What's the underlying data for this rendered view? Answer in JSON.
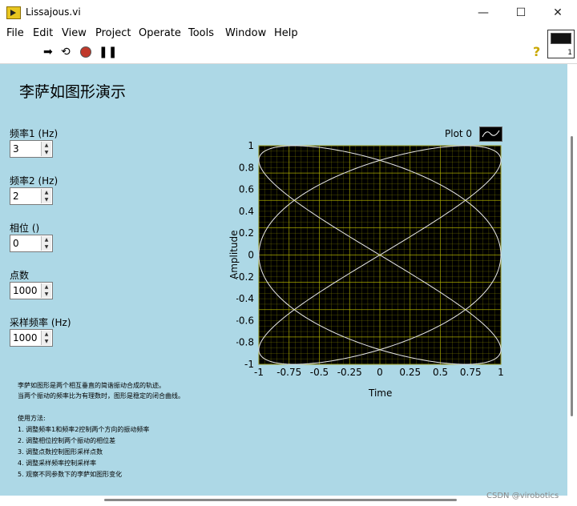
{
  "window": {
    "title": "Lissajous.vi",
    "minimize_glyph": "—",
    "maximize_glyph": "☐",
    "close_glyph": "✕"
  },
  "menu": [
    "File",
    "Edit",
    "View",
    "Project",
    "Operate",
    "Tools",
    "Window",
    "Help"
  ],
  "toolbar": {
    "run_icon": "run-arrow-icon",
    "run_continuous_icon": "run-continuously-icon",
    "abort_icon": "abort-icon",
    "pause_icon": "pause-icon",
    "help_icon": "?"
  },
  "vi_icon": {
    "number": "1"
  },
  "panel": {
    "title": "李萨如图形演示",
    "background": "#add8e6"
  },
  "controls": [
    {
      "label": "频率1 (Hz)",
      "value": "3"
    },
    {
      "label": "频率2 (Hz)",
      "value": "2"
    },
    {
      "label": "相位 ()",
      "value": "0"
    },
    {
      "label": "点数",
      "value": "1000"
    },
    {
      "label": "采样频率 (Hz)",
      "value": "1000"
    }
  ],
  "description": [
    "李萨如图形是两个相互垂直的简谐振动合成的轨迹。",
    "当两个振动的频率比为有理数时，图形是稳定的闭合曲线。",
    "",
    "使用方法:",
    "1. 调整频率1和频率2控制两个方向的振动频率",
    "2. 调整相位控制两个振动的相位差",
    "3. 调整点数控制图形采样点数",
    "4. 调整采样频率控制采样率",
    "5. 观察不同参数下的李萨如图形变化"
  ],
  "chart_data": {
    "type": "line",
    "xlabel": "Time",
    "ylabel": "Amplitude",
    "legend": "Plot 0",
    "xlim": [
      -1,
      1
    ],
    "ylim": [
      -1,
      1
    ],
    "xticks": [
      "-1",
      "-0.75",
      "-0.5",
      "-0.25",
      "0",
      "0.25",
      "0.5",
      "0.75",
      "1"
    ],
    "yticks": [
      "1",
      "0.8",
      "0.6",
      "0.4",
      "0.2",
      "0",
      "-0.2",
      "-0.4",
      "-0.6",
      "-0.8",
      "-1"
    ],
    "grid": true,
    "series": [
      {
        "name": "Plot 0",
        "fx": 3,
        "fy": 2,
        "phase": 0
      }
    ],
    "colors": {
      "background": "#000000",
      "grid": "#b8b800",
      "line": "#e8e8e8"
    }
  },
  "watermark": "CSDN @virobotics"
}
